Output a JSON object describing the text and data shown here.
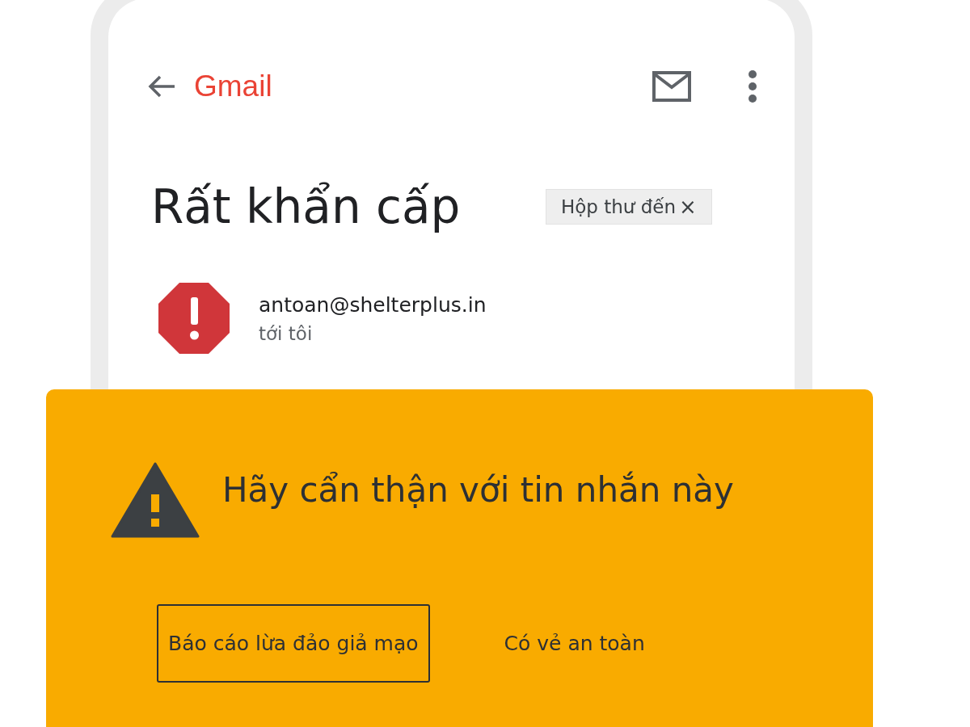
{
  "header": {
    "logo": "Gmail"
  },
  "subject": "Rất khẩn cấp",
  "label_chip": {
    "label": "Hộp thư đến",
    "close": "×"
  },
  "sender": {
    "email": "antoan@shelterplus.in",
    "recipient": "tới tôi"
  },
  "warning": {
    "title": "Hãy cẩn thận với tin nhắn này",
    "buttons": [
      {
        "label": "Báo cáo lừa đảo giả mạo",
        "kind": "outlined"
      },
      {
        "label": "Có vẻ an toàn",
        "kind": "text"
      }
    ]
  }
}
